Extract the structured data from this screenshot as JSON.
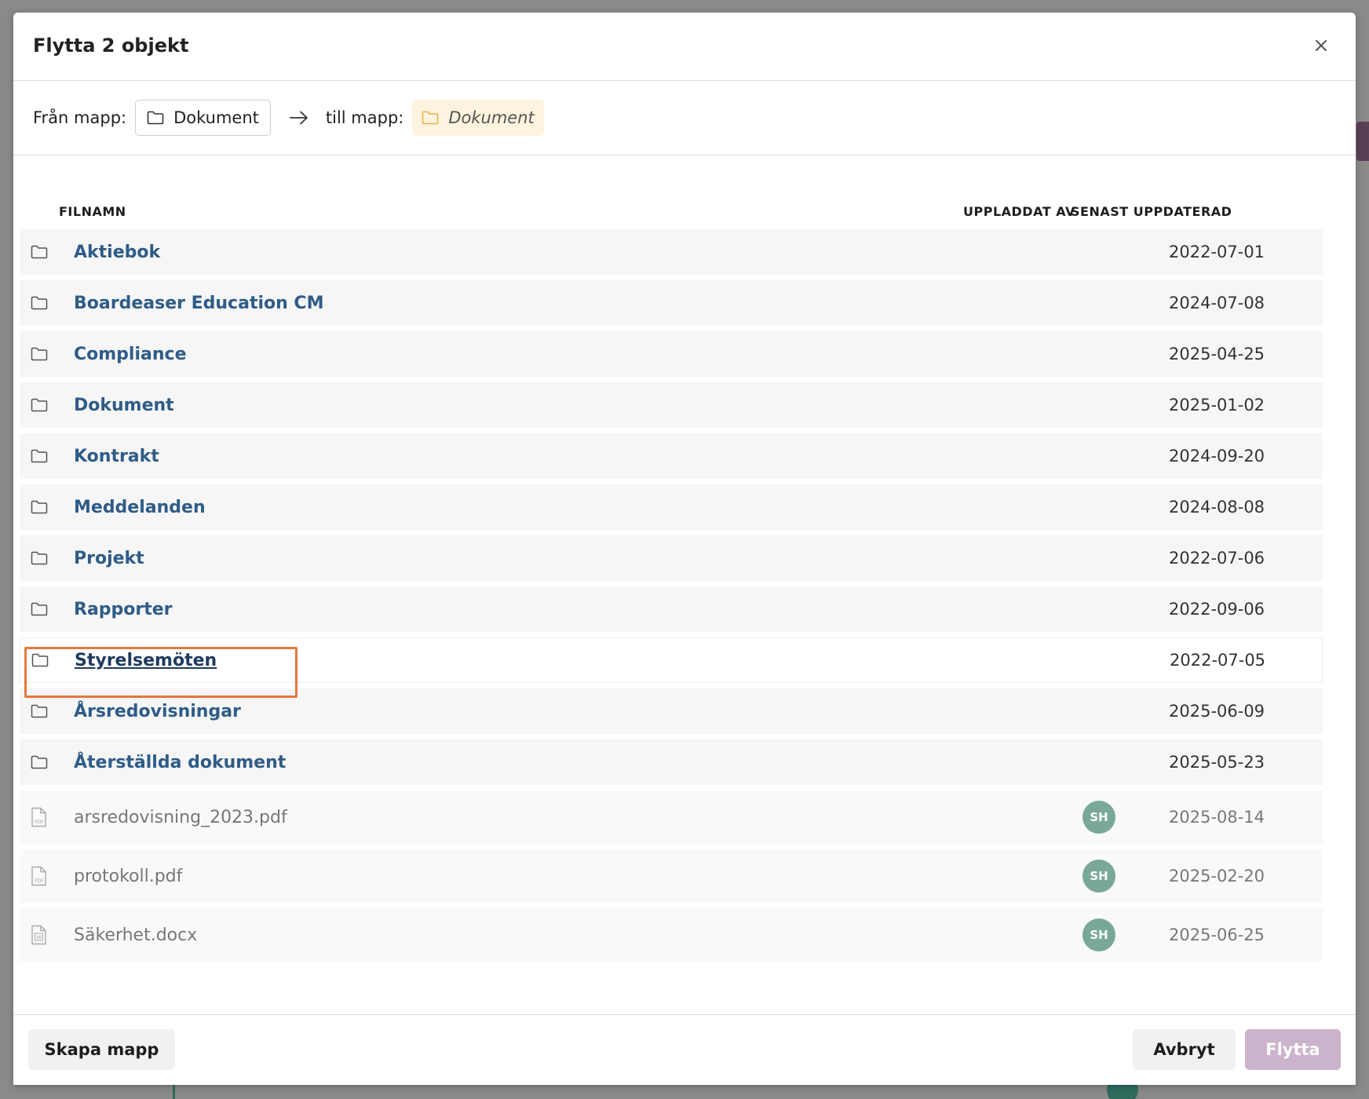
{
  "dialog": {
    "title": "Flytta 2 objekt",
    "from_label": "Från mapp:",
    "from_folder": "Dokument",
    "to_label": "till mapp:",
    "to_folder": "Dokument"
  },
  "table": {
    "columns": {
      "name": "FILNAMN",
      "uploaded_by": "UPPLADDAT AV",
      "last_updated": "SENAST UPPDATERAD"
    },
    "rows": [
      {
        "type": "folder",
        "name": "Aktiebok",
        "uploader": "",
        "updated": "2022-07-01"
      },
      {
        "type": "folder",
        "name": "Boardeaser Education CM",
        "uploader": "",
        "updated": "2024-07-08"
      },
      {
        "type": "folder",
        "name": "Compliance",
        "uploader": "",
        "updated": "2025-04-25"
      },
      {
        "type": "folder",
        "name": "Dokument",
        "uploader": "",
        "updated": "2025-01-02"
      },
      {
        "type": "folder",
        "name": "Kontrakt",
        "uploader": "",
        "updated": "2024-09-20"
      },
      {
        "type": "folder",
        "name": "Meddelanden",
        "uploader": "",
        "updated": "2024-08-08"
      },
      {
        "type": "folder",
        "name": "Projekt",
        "uploader": "",
        "updated": "2022-07-06"
      },
      {
        "type": "folder",
        "name": "Rapporter",
        "uploader": "",
        "updated": "2022-09-06"
      },
      {
        "type": "folder",
        "name": "Styrelsemöten",
        "uploader": "",
        "updated": "2022-07-05",
        "highlighted": true
      },
      {
        "type": "folder",
        "name": "Årsredovisningar",
        "uploader": "",
        "updated": "2025-06-09"
      },
      {
        "type": "folder",
        "name": "Återställda dokument",
        "uploader": "",
        "updated": "2025-05-23"
      },
      {
        "type": "pdf",
        "name": "arsredovisning_2023.pdf",
        "uploader": "SH",
        "updated": "2025-08-14"
      },
      {
        "type": "pdf",
        "name": "protokoll.pdf",
        "uploader": "SH",
        "updated": "2025-02-20"
      },
      {
        "type": "docx",
        "name": "Säkerhet.docx",
        "uploader": "SH",
        "updated": "2025-06-25"
      }
    ]
  },
  "footer": {
    "create_folder": "Skapa mapp",
    "cancel": "Avbryt",
    "move": "Flytta"
  },
  "colors": {
    "folder_link": "#2e5c87",
    "target_chip_bg": "#fdf3de",
    "avatar_bg": "#79a89b",
    "move_button_disabled": "#cbb4cb",
    "focus_outline": "#e8773b"
  }
}
